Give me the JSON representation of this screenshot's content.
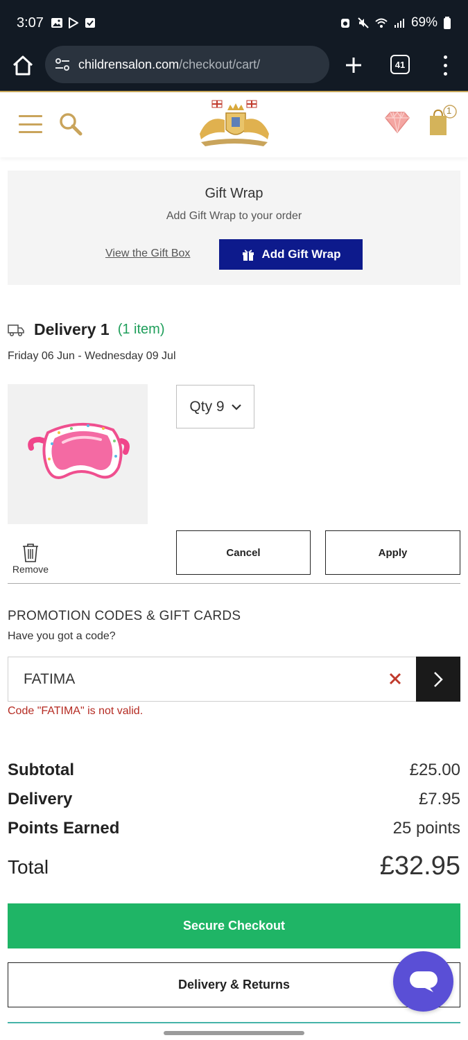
{
  "status_bar": {
    "time": "3:07",
    "battery": "69%"
  },
  "browser": {
    "url_host": "childrensalon.com",
    "url_path": "/checkout/cart/",
    "tab_count": "41"
  },
  "header": {
    "bag_count": "1"
  },
  "gift_wrap": {
    "title": "Gift Wrap",
    "subtitle": "Add Gift Wrap to your order",
    "view_link": "View the Gift Box",
    "add_button": "Add Gift Wrap"
  },
  "delivery": {
    "title": "Delivery 1",
    "count": "(1 item)",
    "dates": "Friday 06 Jun - Wednesday 09 Jul"
  },
  "item": {
    "qty_label": "Qty 9",
    "remove_label": "Remove",
    "cancel_button": "Cancel",
    "apply_button": "Apply"
  },
  "promo": {
    "title": "PROMOTION CODES & GIFT CARDS",
    "subtitle": "Have you got a code?",
    "code_value": "FATIMA",
    "error": "Code \"FATIMA\" is not valid."
  },
  "totals": {
    "subtotal_label": "Subtotal",
    "subtotal_value": "£25.00",
    "delivery_label": "Delivery",
    "delivery_value": "£7.95",
    "points_label": "Points Earned",
    "points_value": "25 points",
    "total_label": "Total",
    "total_value": "£32.95"
  },
  "actions": {
    "checkout_button": "Secure Checkout",
    "returns_button": "Delivery & Returns"
  },
  "colors": {
    "brand_gold": "#c9a45b",
    "gift_button": "#0d1a8c",
    "checkout_green": "#1fb566",
    "error_red": "#b52b22",
    "chat_purple": "#5a4fd6"
  }
}
